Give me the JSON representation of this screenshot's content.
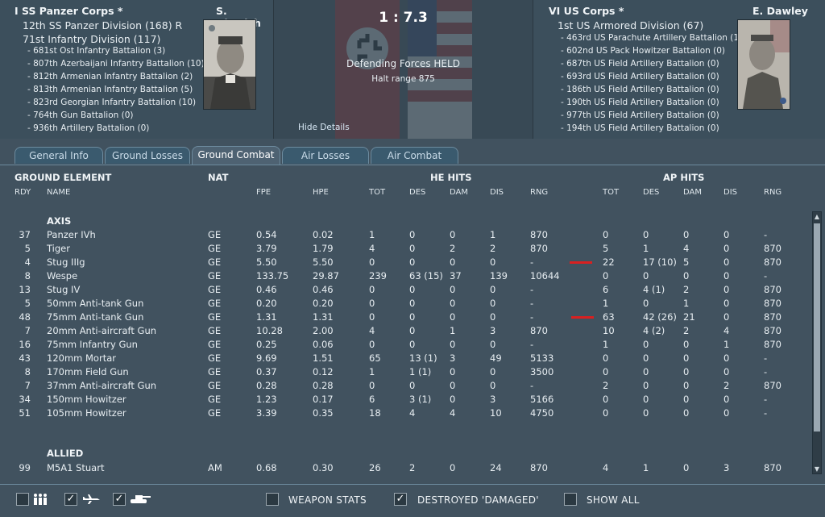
{
  "axis_side": {
    "corps": "I SS Panzer Corps *",
    "leader": "S. Dietrich",
    "divisions": [
      "12th SS Panzer Division (168) R",
      "71st Infantry Division (117)"
    ],
    "units": [
      "- 681st Ost Infantry Battalion (3)",
      "- 807th Azerbaijani Infantry Battalion (10)",
      "- 812th Armenian Infantry Battalion (2)",
      "- 813th Armenian Infantry Battalion (5)",
      "- 823rd Georgian Infantry Battalion (10)",
      "- 764th Gun Battalion (0)",
      "- 936th Artillery Battalion (0)"
    ]
  },
  "allied_side": {
    "corps": "VI US Corps *",
    "leader": "E. Dawley",
    "divisions": [
      "1st US Armored Division (67)"
    ],
    "units": [
      "- 463rd US Parachute Artillery Battalion (1)",
      "- 602nd US Pack Howitzer Battalion (0)",
      "- 687th US Field Artillery Battalion (0)",
      "- 693rd US Field Artillery Battalion (0)",
      "- 186th US Field Artillery Battalion (0)",
      "- 190th US Field Artillery Battalion (0)",
      "- 977th US Field Artillery Battalion (0)",
      "- 194th US Field Artillery Battalion (0)"
    ]
  },
  "center": {
    "ratio": "1 : 7.3",
    "result": "Defending Forces HELD",
    "halt": "Halt range 875",
    "hide_details": "Hide Details"
  },
  "tabs": [
    "General Info",
    "Ground Losses",
    "Ground Combat",
    "Air Losses",
    "Air Combat"
  ],
  "active_tab": "Ground Combat",
  "headers": {
    "ground_element": "GROUND ELEMENT",
    "nat": "NAT",
    "he_hits": "HE HITS",
    "ap_hits": "AP HITS",
    "cols": [
      "RDY",
      "NAME",
      "FPE",
      "HPE",
      "TOT",
      "DES",
      "DAM",
      "DIS",
      "RNG",
      "TOT",
      "DES",
      "DAM",
      "DIS",
      "RNG"
    ]
  },
  "sections": {
    "axis": "AXIS",
    "allied": "ALLIED"
  },
  "axis_rows": [
    [
      "37",
      "Panzer IVh",
      "GE",
      "0.54",
      "0.02",
      "1",
      "0",
      "0",
      "1",
      "870",
      "0",
      "0",
      "0",
      "0",
      "-"
    ],
    [
      "5",
      "Tiger",
      "GE",
      "3.79",
      "1.79",
      "4",
      "0",
      "2",
      "2",
      "870",
      "5",
      "1",
      "4",
      "0",
      "870"
    ],
    [
      "4",
      "Stug IIIg",
      "GE",
      "5.50",
      "5.50",
      "0",
      "0",
      "0",
      "0",
      "-",
      "22",
      "17 (10)",
      "5",
      "0",
      "870"
    ],
    [
      "8",
      "Wespe",
      "GE",
      "133.75",
      "29.87",
      "239",
      "63 (15)",
      "37",
      "139",
      "10644",
      "0",
      "0",
      "0",
      "0",
      "-"
    ],
    [
      "13",
      "Stug IV",
      "GE",
      "0.46",
      "0.46",
      "0",
      "0",
      "0",
      "0",
      "-",
      "6",
      "4 (1)",
      "2",
      "0",
      "870"
    ],
    [
      "5",
      "50mm Anti-tank Gun",
      "GE",
      "0.20",
      "0.20",
      "0",
      "0",
      "0",
      "0",
      "-",
      "1",
      "0",
      "1",
      "0",
      "870"
    ],
    [
      "48",
      "75mm Anti-tank Gun",
      "GE",
      "1.31",
      "1.31",
      "0",
      "0",
      "0",
      "0",
      "-",
      "63",
      "42 (26)",
      "21",
      "0",
      "870"
    ],
    [
      "7",
      "20mm Anti-aircraft Gun",
      "GE",
      "10.28",
      "2.00",
      "4",
      "0",
      "1",
      "3",
      "870",
      "10",
      "4 (2)",
      "2",
      "4",
      "870"
    ],
    [
      "16",
      "75mm Infantry Gun",
      "GE",
      "0.25",
      "0.06",
      "0",
      "0",
      "0",
      "0",
      "-",
      "1",
      "0",
      "0",
      "1",
      "870"
    ],
    [
      "43",
      "120mm Mortar",
      "GE",
      "9.69",
      "1.51",
      "65",
      "13 (1)",
      "3",
      "49",
      "5133",
      "0",
      "0",
      "0",
      "0",
      "-"
    ],
    [
      "8",
      "170mm Field Gun",
      "GE",
      "0.37",
      "0.12",
      "1",
      "1 (1)",
      "0",
      "0",
      "3500",
      "0",
      "0",
      "0",
      "0",
      "-"
    ],
    [
      "7",
      "37mm Anti-aircraft Gun",
      "GE",
      "0.28",
      "0.28",
      "0",
      "0",
      "0",
      "0",
      "-",
      "2",
      "0",
      "0",
      "2",
      "870"
    ],
    [
      "34",
      "150mm Howitzer",
      "GE",
      "1.23",
      "0.17",
      "6",
      "3 (1)",
      "0",
      "3",
      "5166",
      "0",
      "0",
      "0",
      "0",
      "-"
    ],
    [
      "51",
      "105mm Howitzer",
      "GE",
      "3.39",
      "0.35",
      "18",
      "4",
      "4",
      "10",
      "4750",
      "0",
      "0",
      "0",
      "0",
      "-"
    ]
  ],
  "allied_rows": [
    [
      "99",
      "M5A1 Stuart",
      "AM",
      "0.68",
      "0.30",
      "26",
      "2",
      "0",
      "24",
      "870",
      "4",
      "1",
      "0",
      "3",
      "870"
    ]
  ],
  "bottom": {
    "weapon_stats": "WEAPON STATS",
    "destroyed_damaged": "DESTROYED 'DAMAGED'",
    "show_all": "SHOW ALL",
    "filters": [
      "infantry-filter-icon",
      "aircraft-filter-icon",
      "tank-filter-icon"
    ],
    "checked": {
      "infantry": false,
      "aircraft": true,
      "tank": true,
      "weapon_stats": false,
      "destroyed_damaged": true,
      "show_all": false
    }
  },
  "colors": {
    "accent": "#6d8b9e",
    "highlight_bar": "#d92020",
    "background": "#41525f"
  }
}
